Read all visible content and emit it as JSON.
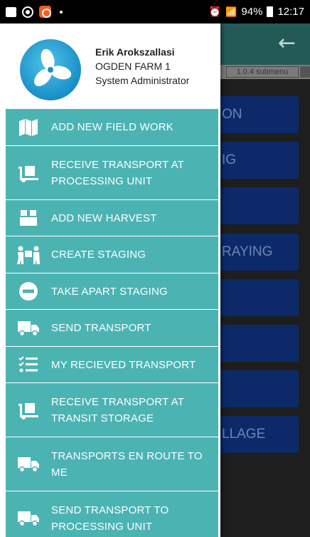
{
  "status": {
    "percent": "94%",
    "time": "12:17"
  },
  "background": {
    "version": "1.0.4 submenu",
    "buttons": [
      "ON",
      "IG",
      "",
      "RAYING",
      "",
      "",
      "",
      "LLAGE"
    ]
  },
  "profile": {
    "name": "Erik Arokszallasi",
    "farm": "OGDEN FARM 1",
    "role": "System Administrator"
  },
  "menu": [
    {
      "label": "ADD NEW FIELD WORK",
      "icon": "map-icon"
    },
    {
      "label": "RECEIVE TRANSPORT AT PROCESSING UNIT",
      "icon": "dolly-icon"
    },
    {
      "label": "ADD NEW HARVEST",
      "icon": "box-icon"
    },
    {
      "label": "CREATE STAGING",
      "icon": "people-carry-icon"
    },
    {
      "label": "TAKE APART STAGING",
      "icon": "minus-circle-icon"
    },
    {
      "label": "SEND TRANSPORT",
      "icon": "truck-icon"
    },
    {
      "label": "MY RECIEVED TRANSPORT",
      "icon": "checklist-icon"
    },
    {
      "label": "RECEIVE TRANSPORT AT TRANSIT STORAGE",
      "icon": "dolly-icon"
    },
    {
      "label": "TRANSPORTS EN ROUTE TO ME",
      "icon": "truck-icon"
    },
    {
      "label": "SEND TRANSPORT TO PROCESSING UNIT",
      "icon": "truck-icon"
    }
  ]
}
